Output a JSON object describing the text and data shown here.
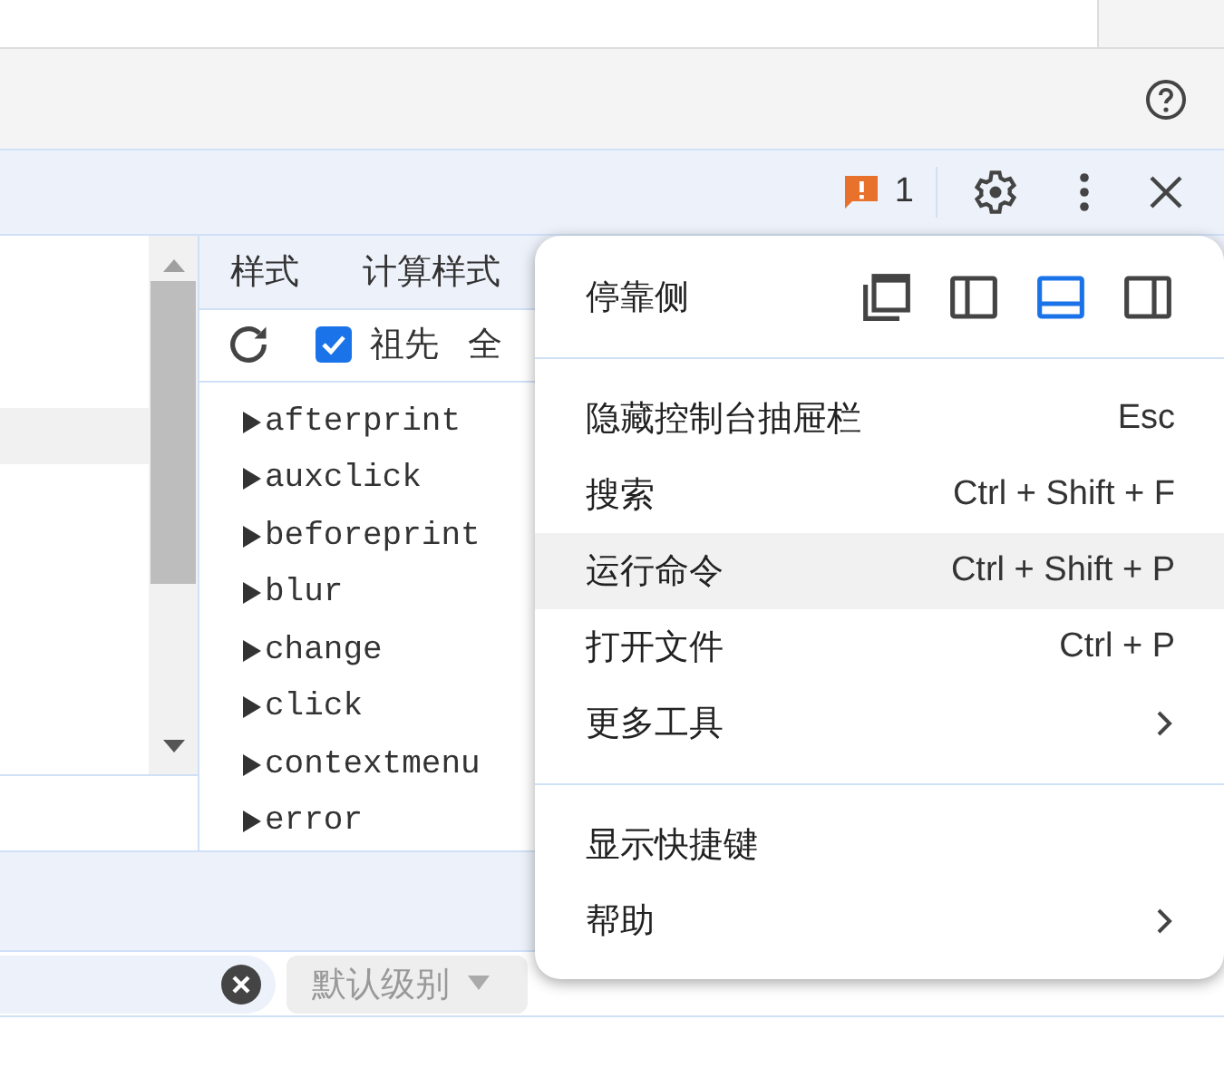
{
  "toolbar": {
    "issues_count": "1"
  },
  "styles_panel": {
    "tabs": [
      {
        "label": "样式",
        "selected": false
      },
      {
        "label": "计算样式",
        "selected": false
      }
    ],
    "ancestors": {
      "label": "祖先",
      "checked": true
    },
    "all_label": "全",
    "events": [
      "afterprint",
      "auxclick",
      "beforeprint",
      "blur",
      "change",
      "click",
      "contextmenu",
      "error"
    ]
  },
  "console": {
    "level_dropdown": "默认级别"
  },
  "menu": {
    "dock": {
      "label": "停靠侧",
      "options": [
        {
          "kind": "undock",
          "selected": false
        },
        {
          "kind": "left",
          "selected": false
        },
        {
          "kind": "bottom",
          "selected": true
        },
        {
          "kind": "right",
          "selected": false
        }
      ]
    },
    "sections": [
      [
        {
          "label": "隐藏控制台抽屉栏",
          "shortcut": "Esc",
          "kind": "item",
          "highlighted": false
        },
        {
          "label": "搜索",
          "shortcut": "Ctrl + Shift + F",
          "kind": "item",
          "highlighted": false
        },
        {
          "label": "运行命令",
          "shortcut": "Ctrl + Shift + P",
          "kind": "item",
          "highlighted": true
        },
        {
          "label": "打开文件",
          "shortcut": "Ctrl + P",
          "kind": "item",
          "highlighted": false
        },
        {
          "label": "更多工具",
          "kind": "submenu",
          "highlighted": false
        }
      ],
      [
        {
          "label": "显示快捷键",
          "kind": "item",
          "highlighted": false
        },
        {
          "label": "帮助",
          "kind": "submenu",
          "highlighted": false
        }
      ]
    ]
  }
}
